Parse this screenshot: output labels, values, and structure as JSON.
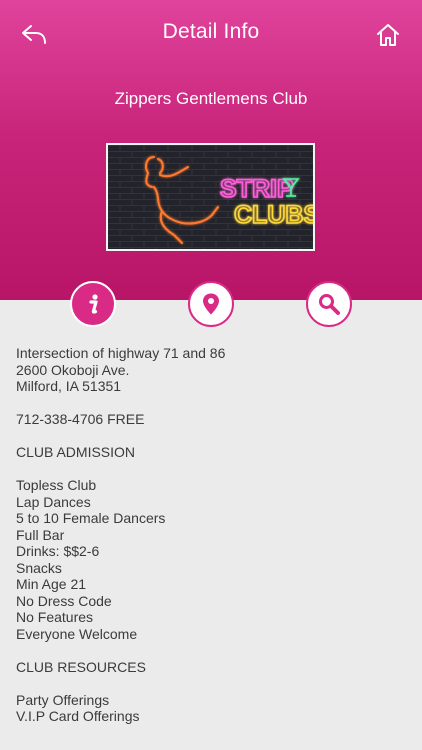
{
  "header": {
    "title": "Detail Info"
  },
  "venue": {
    "name": "Zippers Gentlemens Club",
    "banner_text_top": "STRIP",
    "banner_text_bottom": "CLUBS"
  },
  "tabs": [
    {
      "icon": "info-icon",
      "active": true
    },
    {
      "icon": "map-pin-icon",
      "active": false
    },
    {
      "icon": "search-icon",
      "active": false
    }
  ],
  "details": [
    "Intersection of highway 71 and 86",
    "2600 Okoboji Ave.",
    "Milford, IA 51351",
    "",
    "712-338-4706 FREE",
    "",
    "CLUB ADMISSION",
    "",
    "Topless Club",
    "Lap Dances",
    "5 to 10 Female Dancers",
    "Full Bar",
    "Drinks: $$2-6",
    "Snacks",
    "Min Age 21",
    "No Dress Code",
    "No Features",
    "Everyone Welcome",
    "",
    "CLUB RESOURCES",
    "",
    "Party Offerings",
    "V.I.P Card Offerings"
  ],
  "colors": {
    "accent": "#d92a86",
    "header_top": "#e0439c",
    "header_bottom": "#b81567",
    "background": "#ebebeb",
    "text": "#3b3b3b"
  }
}
